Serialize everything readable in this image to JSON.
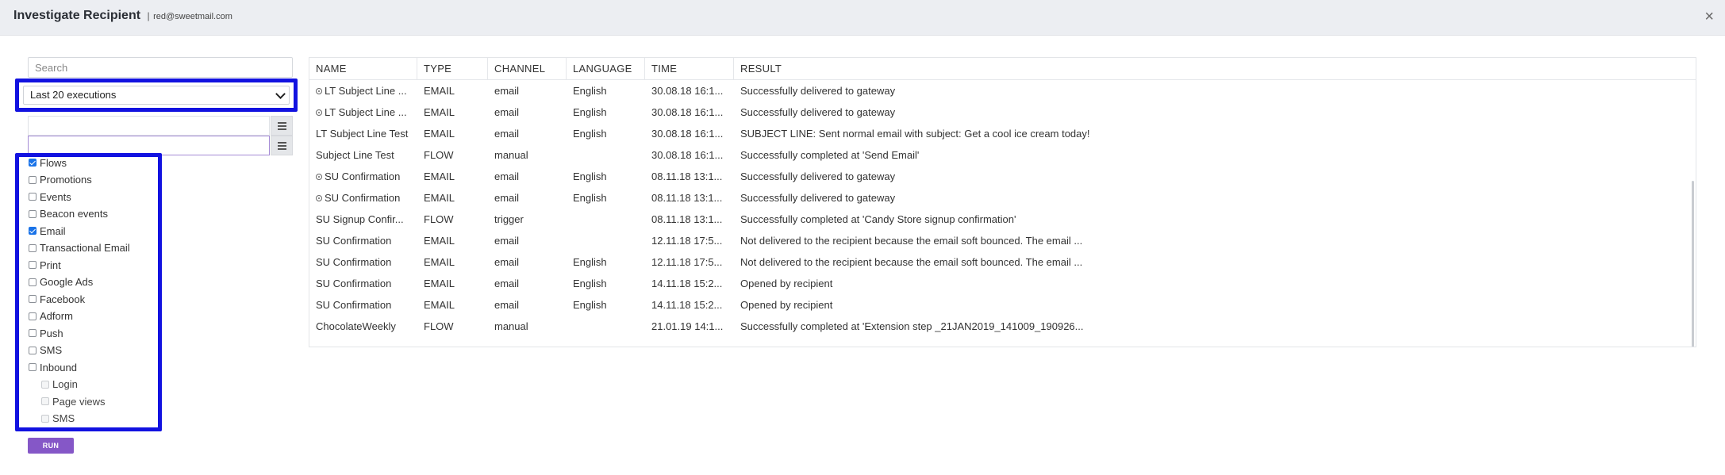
{
  "header": {
    "title": "Investigate Recipient",
    "separator": "|",
    "email": "red@sweetmail.com",
    "close_label": "×"
  },
  "search": {
    "placeholder": "Search",
    "value": ""
  },
  "executions_select": {
    "selected": "Last 20 executions"
  },
  "filters": [
    {
      "label": "Flows",
      "checked": true,
      "sub": false
    },
    {
      "label": "Promotions",
      "checked": false,
      "sub": false
    },
    {
      "label": "Events",
      "checked": false,
      "sub": false
    },
    {
      "label": "Beacon events",
      "checked": false,
      "sub": false
    },
    {
      "label": "Email",
      "checked": true,
      "sub": false
    },
    {
      "label": "Transactional Email",
      "checked": false,
      "sub": false
    },
    {
      "label": "Print",
      "checked": false,
      "sub": false
    },
    {
      "label": "Google Ads",
      "checked": false,
      "sub": false
    },
    {
      "label": "Facebook",
      "checked": false,
      "sub": false
    },
    {
      "label": "Adform",
      "checked": false,
      "sub": false
    },
    {
      "label": "Push",
      "checked": false,
      "sub": false
    },
    {
      "label": "SMS",
      "checked": false,
      "sub": false
    },
    {
      "label": "Inbound",
      "checked": false,
      "sub": false
    },
    {
      "label": "Login",
      "checked": false,
      "sub": true
    },
    {
      "label": "Page views",
      "checked": false,
      "sub": true
    },
    {
      "label": "SMS",
      "checked": false,
      "sub": true
    }
  ],
  "run_label": "RUN",
  "table": {
    "columns": [
      "NAME",
      "TYPE",
      "CHANNEL",
      "LANGUAGE",
      "TIME",
      "RESULT"
    ],
    "rows": [
      {
        "icon": true,
        "name": "LT Subject Line ...",
        "type": "EMAIL",
        "channel": "email",
        "language": "English",
        "time": "30.08.18 16:1...",
        "result": "Successfully delivered to gateway"
      },
      {
        "icon": true,
        "name": "LT Subject Line ...",
        "type": "EMAIL",
        "channel": "email",
        "language": "English",
        "time": "30.08.18 16:1...",
        "result": "Successfully delivered to gateway"
      },
      {
        "icon": false,
        "name": "LT Subject Line Test",
        "type": "EMAIL",
        "channel": "email",
        "language": "English",
        "time": "30.08.18 16:1...",
        "result": "SUBJECT LINE: Sent normal email with subject: Get a cool ice cream today!"
      },
      {
        "icon": false,
        "name": "Subject Line Test",
        "type": "FLOW",
        "channel": "manual",
        "language": "",
        "time": "30.08.18 16:1...",
        "result": "Successfully completed at 'Send Email'"
      },
      {
        "icon": true,
        "name": "SU Confirmation",
        "type": "EMAIL",
        "channel": "email",
        "language": "English",
        "time": "08.11.18 13:1...",
        "result": "Successfully delivered to gateway"
      },
      {
        "icon": true,
        "name": "SU Confirmation",
        "type": "EMAIL",
        "channel": "email",
        "language": "English",
        "time": "08.11.18 13:1...",
        "result": "Successfully delivered to gateway"
      },
      {
        "icon": false,
        "name": "SU Signup Confir...",
        "type": "FLOW",
        "channel": "trigger",
        "language": "",
        "time": "08.11.18 13:1...",
        "result": "Successfully completed at 'Candy Store signup confirmation'"
      },
      {
        "icon": false,
        "name": "SU Confirmation",
        "type": "EMAIL",
        "channel": "email",
        "language": "",
        "time": "12.11.18 17:5...",
        "result": "Not delivered to the recipient because the email soft bounced. The email ..."
      },
      {
        "icon": false,
        "name": "SU Confirmation",
        "type": "EMAIL",
        "channel": "email",
        "language": "English",
        "time": "12.11.18 17:5...",
        "result": "Not delivered to the recipient because the email soft bounced. The email ..."
      },
      {
        "icon": false,
        "name": "SU Confirmation",
        "type": "EMAIL",
        "channel": "email",
        "language": "English",
        "time": "14.11.18 15:2...",
        "result": "Opened by recipient"
      },
      {
        "icon": false,
        "name": "SU Confirmation",
        "type": "EMAIL",
        "channel": "email",
        "language": "English",
        "time": "14.11.18 15:2...",
        "result": "Opened by recipient"
      },
      {
        "icon": false,
        "name": "ChocolateWeekly",
        "type": "FLOW",
        "channel": "manual",
        "language": "",
        "time": "21.01.19 14:1...",
        "result": "Successfully completed at 'Extension step _21JAN2019_141009_190926..."
      }
    ]
  }
}
